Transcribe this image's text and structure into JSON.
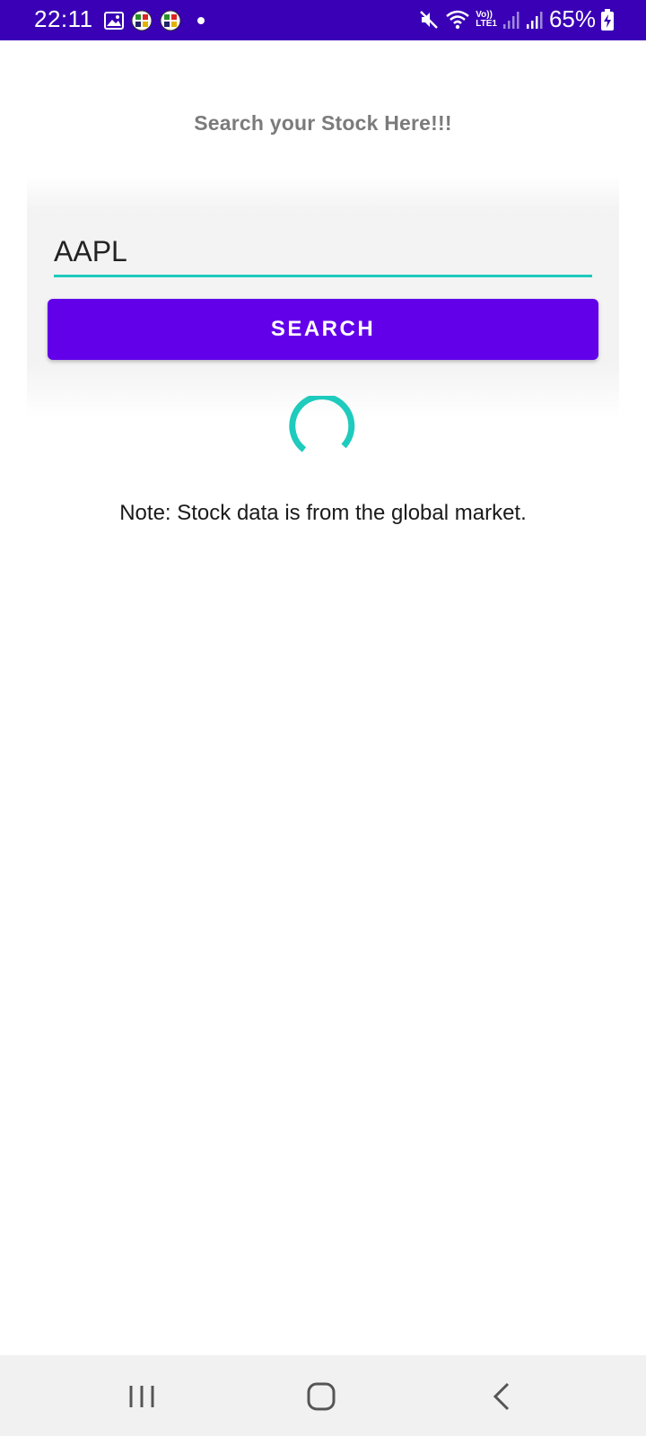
{
  "status_bar": {
    "time": "22:11",
    "battery": "65%",
    "background_color": "#3a00b5",
    "left_icons": [
      "gallery-icon",
      "app-icon",
      "app-icon",
      "dot-icon"
    ],
    "right_icons": [
      "mute-icon",
      "wifi-icon",
      "volte-lte-icon",
      "signal-icon",
      "signal-icon",
      "battery-charging-icon"
    ],
    "volte_label_top": "Vo))",
    "volte_label_bottom": "LTE1"
  },
  "page": {
    "title": "Search your Stock Here!!!",
    "title_color": "#7b7b7b"
  },
  "search": {
    "value": "AAPL",
    "accent_color": "#1ecbbd",
    "button_label": "SEARCH",
    "button_color": "#6200ea"
  },
  "loading": {
    "spinner_color": "#1ecbbd"
  },
  "note": "Note: Stock data is from the global market.",
  "nav_bar": {
    "buttons": [
      "recents-icon",
      "home-icon",
      "back-icon"
    ]
  }
}
